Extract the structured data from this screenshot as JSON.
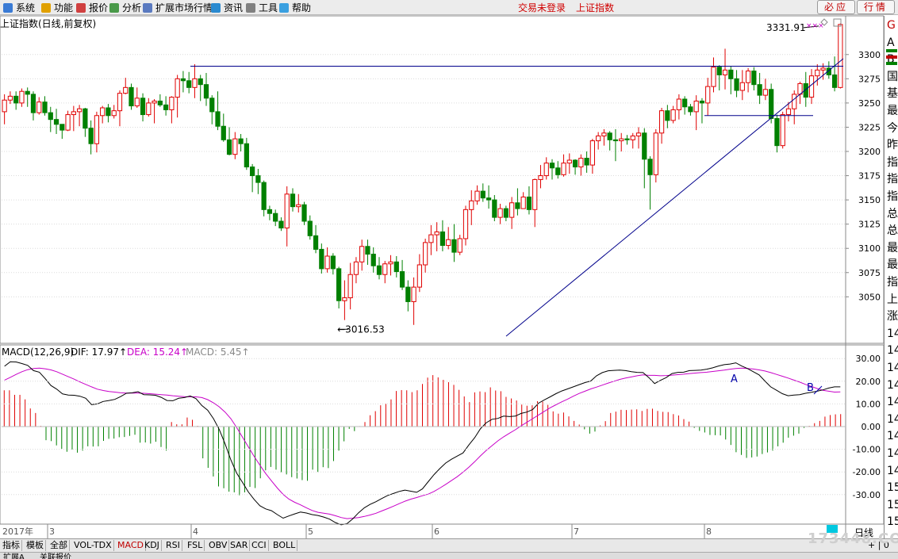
{
  "menu": {
    "items": [
      "系统",
      "功能",
      "报价",
      "分析",
      "扩展市场行情",
      "资讯",
      "工具",
      "帮助"
    ],
    "status_login": "交易未登录",
    "status_index": "上证指数",
    "btn_bida": "必应",
    "btn_hangqing": "行情"
  },
  "chart": {
    "title": "上证指数(日线,前复权)",
    "high_label": "3331.91",
    "low_label": "3016.53",
    "price_axis": [
      "3300",
      "3275",
      "3250",
      "3225",
      "3200",
      "3175",
      "3150",
      "3125",
      "3100",
      "3075",
      "3050"
    ],
    "annotation_a": "A",
    "annotation_b": "B"
  },
  "macd": {
    "title": "MACD(12,26,9)",
    "dif": "DIF: 17.97",
    "dea": "DEA: 15.24",
    "macd": "MACD: 5.45",
    "axis": [
      "30.00",
      "20.00",
      "10.00",
      "0.00",
      "-10.00",
      "-20.00",
      "-30.00"
    ]
  },
  "time_axis": {
    "year": "2017年",
    "months": [
      "3",
      "4",
      "5",
      "6",
      "7",
      "8"
    ]
  },
  "right_panel": [
    "G",
    "A",
    "B",
    "国",
    "基",
    "最",
    "今",
    "昨",
    "指",
    "指",
    "指",
    "总",
    "总",
    "最",
    "最",
    "指",
    "上",
    "涨",
    "14",
    "14",
    "14",
    "14",
    "14",
    "14",
    "14",
    "14",
    "14",
    "15",
    "15",
    "15"
  ],
  "bottom_tabs": [
    "指标",
    "模板",
    "全部",
    "VOL-TDX",
    "MACD",
    "KDJ",
    "RSI",
    "FSL",
    "OBV",
    "SAR",
    "CCI",
    "BOLL"
  ],
  "active_tab": "MACD",
  "bottom_extra": [
    "扩展A",
    "关联报价"
  ],
  "period_label": "日线",
  "period_ctrl": "+ | 0",
  "watermark": "173448.COM",
  "colors": {
    "up": "#e00000",
    "down": "#008000",
    "dif": "#000000",
    "dea": "#c800c8",
    "trendline": "#00008b"
  },
  "candles": [
    [
      3241,
      3253,
      3228,
      3259
    ],
    [
      3253,
      3257,
      3249,
      3262
    ],
    [
      3257,
      3250,
      3243,
      3262
    ],
    [
      3250,
      3262,
      3246,
      3265
    ],
    [
      3262,
      3259,
      3246,
      3266
    ],
    [
      3259,
      3240,
      3232,
      3262
    ],
    [
      3240,
      3251,
      3238,
      3256
    ],
    [
      3251,
      3240,
      3237,
      3257
    ],
    [
      3240,
      3233,
      3220,
      3246
    ],
    [
      3233,
      3228,
      3218,
      3244
    ],
    [
      3228,
      3222,
      3213,
      3228
    ],
    [
      3222,
      3238,
      3221,
      3242
    ],
    [
      3238,
      3241,
      3221,
      3247
    ],
    [
      3241,
      3244,
      3226,
      3248
    ],
    [
      3244,
      3224,
      3215,
      3245
    ],
    [
      3224,
      3208,
      3197,
      3232
    ],
    [
      3208,
      3237,
      3199,
      3241
    ],
    [
      3237,
      3245,
      3229,
      3247
    ],
    [
      3245,
      3237,
      3230,
      3249
    ],
    [
      3237,
      3242,
      3234,
      3248
    ],
    [
      3242,
      3260,
      3226,
      3263
    ],
    [
      3260,
      3266,
      3259,
      3276
    ],
    [
      3266,
      3247,
      3243,
      3270
    ],
    [
      3247,
      3255,
      3245,
      3266
    ],
    [
      3255,
      3238,
      3231,
      3260
    ],
    [
      3238,
      3250,
      3236,
      3255
    ],
    [
      3250,
      3252,
      3229,
      3254
    ],
    [
      3252,
      3248,
      3246,
      3259
    ],
    [
      3248,
      3243,
      3237,
      3257
    ],
    [
      3243,
      3256,
      3229,
      3257
    ],
    [
      3256,
      3275,
      3235,
      3279
    ],
    [
      3275,
      3273,
      3261,
      3283
    ],
    [
      3273,
      3266,
      3260,
      3282
    ],
    [
      3266,
      3275,
      3255,
      3290
    ],
    [
      3275,
      3269,
      3252,
      3279
    ],
    [
      3269,
      3255,
      3247,
      3281
    ],
    [
      3255,
      3241,
      3228,
      3258
    ],
    [
      3241,
      3226,
      3222,
      3262
    ],
    [
      3226,
      3212,
      3210,
      3239
    ],
    [
      3212,
      3197,
      3196,
      3225
    ],
    [
      3197,
      3213,
      3192,
      3220
    ],
    [
      3213,
      3208,
      3200,
      3218
    ],
    [
      3208,
      3184,
      3181,
      3214
    ],
    [
      3184,
      3175,
      3158,
      3187
    ],
    [
      3175,
      3168,
      3156,
      3182
    ],
    [
      3168,
      3140,
      3133,
      3170
    ],
    [
      3140,
      3136,
      3129,
      3144
    ],
    [
      3136,
      3128,
      3123,
      3140
    ],
    [
      3128,
      3121,
      3118,
      3132
    ],
    [
      3121,
      3156,
      3102,
      3164
    ],
    [
      3156,
      3143,
      3138,
      3162
    ],
    [
      3143,
      3145,
      3137,
      3156
    ],
    [
      3145,
      3128,
      3124,
      3148
    ],
    [
      3128,
      3113,
      3109,
      3134
    ],
    [
      3113,
      3099,
      3095,
      3124
    ],
    [
      3099,
      3079,
      3074,
      3105
    ],
    [
      3079,
      3092,
      3075,
      3101
    ],
    [
      3092,
      3079,
      3073,
      3095
    ],
    [
      3079,
      3046,
      3038,
      3081
    ],
    [
      3046,
      3049,
      3026,
      3067
    ],
    [
      3049,
      3073,
      3037,
      3085
    ],
    [
      3073,
      3086,
      3064,
      3091
    ],
    [
      3086,
      3102,
      3077,
      3109
    ],
    [
      3102,
      3094,
      3083,
      3109
    ],
    [
      3094,
      3082,
      3075,
      3101
    ],
    [
      3082,
      3073,
      3068,
      3091
    ],
    [
      3073,
      3084,
      3064,
      3087
    ],
    [
      3084,
      3086,
      3072,
      3093
    ],
    [
      3086,
      3076,
      3070,
      3092
    ],
    [
      3076,
      3060,
      3057,
      3088
    ],
    [
      3060,
      3045,
      3035,
      3067
    ],
    [
      3045,
      3060,
      3021,
      3070
    ],
    [
      3060,
      3083,
      3055,
      3094
    ],
    [
      3083,
      3106,
      3075,
      3110
    ],
    [
      3106,
      3114,
      3093,
      3124
    ],
    [
      3114,
      3117,
      3097,
      3127
    ],
    [
      3117,
      3103,
      3097,
      3129
    ],
    [
      3103,
      3109,
      3099,
      3122
    ],
    [
      3109,
      3096,
      3086,
      3125
    ],
    [
      3096,
      3110,
      3093,
      3114
    ],
    [
      3110,
      3140,
      3103,
      3144
    ],
    [
      3140,
      3149,
      3124,
      3160
    ],
    [
      3149,
      3159,
      3145,
      3165
    ],
    [
      3159,
      3152,
      3148,
      3167
    ],
    [
      3152,
      3150,
      3141,
      3165
    ],
    [
      3150,
      3132,
      3128,
      3155
    ],
    [
      3132,
      3141,
      3125,
      3146
    ],
    [
      3141,
      3132,
      3128,
      3144
    ],
    [
      3132,
      3147,
      3120,
      3153
    ],
    [
      3147,
      3141,
      3134,
      3162
    ],
    [
      3141,
      3153,
      3141,
      3158
    ],
    [
      3153,
      3140,
      3135,
      3164
    ],
    [
      3140,
      3171,
      3122,
      3172
    ],
    [
      3171,
      3175,
      3162,
      3186
    ],
    [
      3175,
      3188,
      3171,
      3194
    ],
    [
      3188,
      3183,
      3171,
      3192
    ],
    [
      3183,
      3176,
      3172,
      3190
    ],
    [
      3176,
      3188,
      3174,
      3197
    ],
    [
      3188,
      3191,
      3177,
      3198
    ],
    [
      3191,
      3184,
      3176,
      3192
    ],
    [
      3184,
      3193,
      3175,
      3197
    ],
    [
      3193,
      3186,
      3178,
      3200
    ],
    [
      3186,
      3211,
      3177,
      3213
    ],
    [
      3211,
      3216,
      3202,
      3220
    ],
    [
      3216,
      3219,
      3206,
      3223
    ],
    [
      3219,
      3212,
      3201,
      3221
    ],
    [
      3212,
      3211,
      3190,
      3223
    ],
    [
      3211,
      3213,
      3200,
      3219
    ],
    [
      3213,
      3212,
      3207,
      3217
    ],
    [
      3212,
      3216,
      3203,
      3219
    ],
    [
      3216,
      3219,
      3203,
      3225
    ],
    [
      3219,
      3192,
      3162,
      3224
    ],
    [
      3192,
      3176,
      3140,
      3195
    ],
    [
      3176,
      3219,
      3168,
      3223
    ],
    [
      3219,
      3242,
      3208,
      3245
    ],
    [
      3242,
      3232,
      3224,
      3248
    ],
    [
      3232,
      3243,
      3229,
      3247
    ],
    [
      3243,
      3254,
      3233,
      3259
    ],
    [
      3254,
      3246,
      3238,
      3257
    ],
    [
      3246,
      3241,
      3237,
      3249
    ],
    [
      3241,
      3252,
      3222,
      3258
    ],
    [
      3252,
      3250,
      3229,
      3255
    ],
    [
      3250,
      3267,
      3237,
      3276
    ],
    [
      3267,
      3287,
      3261,
      3297
    ],
    [
      3287,
      3279,
      3263,
      3289
    ],
    [
      3279,
      3284,
      3264,
      3306
    ],
    [
      3284,
      3275,
      3259,
      3288
    ],
    [
      3275,
      3263,
      3256,
      3284
    ],
    [
      3263,
      3271,
      3253,
      3284
    ],
    [
      3271,
      3283,
      3261,
      3286
    ],
    [
      3283,
      3269,
      3263,
      3287
    ],
    [
      3269,
      3258,
      3249,
      3281
    ],
    [
      3258,
      3264,
      3253,
      3275
    ],
    [
      3264,
      3234,
      3229,
      3270
    ],
    [
      3234,
      3206,
      3199,
      3238
    ],
    [
      3206,
      3238,
      3203,
      3241
    ],
    [
      3238,
      3244,
      3231,
      3251
    ],
    [
      3244,
      3259,
      3228,
      3263
    ],
    [
      3259,
      3270,
      3249,
      3272
    ],
    [
      3270,
      3256,
      3246,
      3282
    ],
    [
      3256,
      3278,
      3249,
      3285
    ],
    [
      3278,
      3284,
      3268,
      3290
    ],
    [
      3284,
      3286,
      3274,
      3291
    ],
    [
      3286,
      3279,
      3275,
      3293
    ],
    [
      3279,
      3266,
      3262,
      3298
    ],
    [
      3266,
      3331,
      3265,
      3332
    ]
  ],
  "dif_values": [
    26.6,
    28.6,
    28.5,
    27.8,
    27,
    24.7,
    24,
    21.2,
    18.1,
    16.5,
    14.4,
    13.9,
    13.8,
    13.4,
    12.5,
    9.7,
    10,
    11.1,
    11.5,
    12,
    13.2,
    14.7,
    14.9,
    15.4,
    14.1,
    14,
    13.8,
    12.9,
    11.5,
    11.4,
    12.5,
    12.8,
    13.5,
    12.3,
    9.3,
    7.2,
    3.5,
    -1.3,
    -7.6,
    -14.7,
    -20.5,
    -24.6,
    -28.8,
    -32.1,
    -34.9,
    -36.3,
    -37.1,
    -38.8,
    -40.4,
    -39.4,
    -38.5,
    -37.7,
    -38.1,
    -38.8,
    -39.2,
    -39.9,
    -40.8,
    -42.3,
    -43.3,
    -42.8,
    -40.7,
    -38,
    -35.8,
    -34.3,
    -33.1,
    -31.7,
    -30.4,
    -29.5,
    -28.6,
    -28,
    -28.5,
    -29,
    -27.5,
    -24.3,
    -21.2,
    -18.5,
    -16.1,
    -14.4,
    -13,
    -11.6,
    -8.1,
    -4.9,
    -0.9,
    1.7,
    3.2,
    3.6,
    4.6,
    4.4,
    4.6,
    5.8,
    6.4,
    7.5,
    10.3,
    11.8,
    13.1,
    14.5,
    15.7,
    16.6,
    17.5,
    18.5,
    19.4,
    20.1,
    22.4,
    23.8,
    24.6,
    24.8,
    24.9,
    24.7,
    24.2,
    23.9,
    23.8,
    21.6,
    19,
    20.4,
    21.6,
    23.4,
    23.9,
    24,
    24.7,
    24.8,
    24.9,
    25.3,
    25.9,
    26.7,
    27.3,
    27.6,
    28.1,
    26.7,
    25.6,
    24.2,
    22.8,
    20.1,
    17.5,
    16,
    14.5,
    13.6,
    13.9,
    14.1,
    14.7,
    15.1,
    15.6,
    16.2,
    17,
    17.5,
    17.5
  ],
  "dea_values": [
    20.5,
    21.7,
    23,
    24.2,
    25.1,
    25.6,
    25.8,
    25.5,
    25,
    24.2,
    23.1,
    22,
    20.9,
    19.7,
    18.6,
    17.5,
    16.5,
    15.9,
    15.5,
    15.2,
    14.9,
    14.8,
    14.8,
    14.8,
    14.7,
    14.5,
    14.3,
    14.1,
    13.9,
    13.6,
    13.4,
    13.2,
    13.1,
    13.1,
    12.8,
    11.9,
    10.5,
    8.7,
    6.4,
    3.5,
    -0.4,
    -4.7,
    -8.9,
    -13.1,
    -17,
    -20.7,
    -24,
    -27.1,
    -29.9,
    -32,
    -33.4,
    -34.5,
    -35.8,
    -37,
    -37.8,
    -38.2,
    -38.6,
    -39.3,
    -40.1,
    -40.6,
    -40.4,
    -40.1,
    -39.6,
    -39,
    -38.2,
    -37.2,
    -36.2,
    -35.1,
    -34,
    -32.9,
    -32,
    -31.3,
    -30.5,
    -29.8,
    -28.6,
    -27.1,
    -25.5,
    -23.8,
    -22.1,
    -20.1,
    -17.9,
    -15.5,
    -12.9,
    -10.5,
    -8.4,
    -6.3,
    -4.5,
    -2.9,
    -1.4,
    0.3,
    1.9,
    3.5,
    5.1,
    6.7,
    8.3,
    9.6,
    10.9,
    12.1,
    13.4,
    14.6,
    15.6,
    16.6,
    17.4,
    18.3,
    19.2,
    20,
    20.8,
    21.4,
    21.9,
    22.4,
    22.8,
    22.6,
    22.6,
    22.4,
    22.5,
    22.7,
    22.9,
    23.1,
    23.4,
    23.6,
    23.8,
    24,
    24.3,
    24.6,
    24.9,
    25.3,
    25.6,
    25.8,
    25.6,
    25.4,
    25,
    24.5,
    23.8,
    23,
    22.2,
    21.4,
    20.5,
    19.6,
    18.6,
    17.7,
    16.8,
    16,
    15.6,
    15.2,
    15.3
  ],
  "macd_bars": [
    16,
    16,
    14,
    14,
    12,
    8,
    6,
    0.3,
    -6,
    -6.4,
    -8.3,
    -9.8,
    -11.1,
    -10.1,
    -11.5,
    -10.6,
    -8.7,
    -8.8,
    -8.7,
    -6.3,
    -5.4,
    -5.3,
    -4.7,
    -4.6,
    -4.1,
    -3.6,
    -7.1,
    -7,
    -7.5,
    -6.7,
    -9,
    -10.6,
    2,
    1,
    1,
    4,
    3,
    0.3,
    -14,
    -18.2,
    -22,
    -26.4,
    -27.2,
    -28.7,
    -29,
    -30.3,
    -29,
    -26.6,
    -27.1,
    -22.8,
    -19.3,
    -17.8,
    -19,
    -20.1,
    -21.1,
    -22.3,
    -22.9,
    -23.6,
    -23.9,
    -19,
    -20,
    -17.9,
    -18.3,
    -15.2,
    -10.6,
    -6.5,
    -1,
    -2,
    0.2,
    2,
    5,
    6.8,
    9.4,
    10,
    12,
    15.7,
    16.1,
    16,
    15.2,
    16,
    18.8,
    21.6,
    22.7,
    21.7,
    20.6,
    19.6,
    18.4,
    16.2,
    13.3,
    10.8,
    15.1,
    15.5,
    15.2,
    17.3,
    15.9,
    15.6,
    13.1,
    12.4,
    11.5,
    9.7,
    9.2,
    9.4,
    11.2,
    11,
    9.6,
    6.7,
    5.7,
    6.2,
    4.5,
    2.5,
    0.9,
    -1.2,
    -3.1,
    -2.2,
    0.5,
    2.4,
    6,
    6.6,
    7.4,
    7.3,
    7.5,
    7.6,
    6.9,
    7.8,
    7.9,
    6.9,
    6.5,
    6.4,
    5.5,
    4.9,
    3.3,
    2.2,
    -0.6,
    -1.9,
    -2.6,
    -3.7,
    -3.8,
    -3.9,
    -5.7,
    -8.1,
    -11.3,
    -12.5,
    -13.8,
    -13.6,
    -13.2,
    -12.1,
    -11.4,
    -10.6,
    -8.7,
    -7.1,
    -4.9,
    -4,
    -3.1,
    -0.6,
    0.3,
    1.5,
    2.5,
    4.4,
    5.1,
    5.4,
    5.5
  ]
}
